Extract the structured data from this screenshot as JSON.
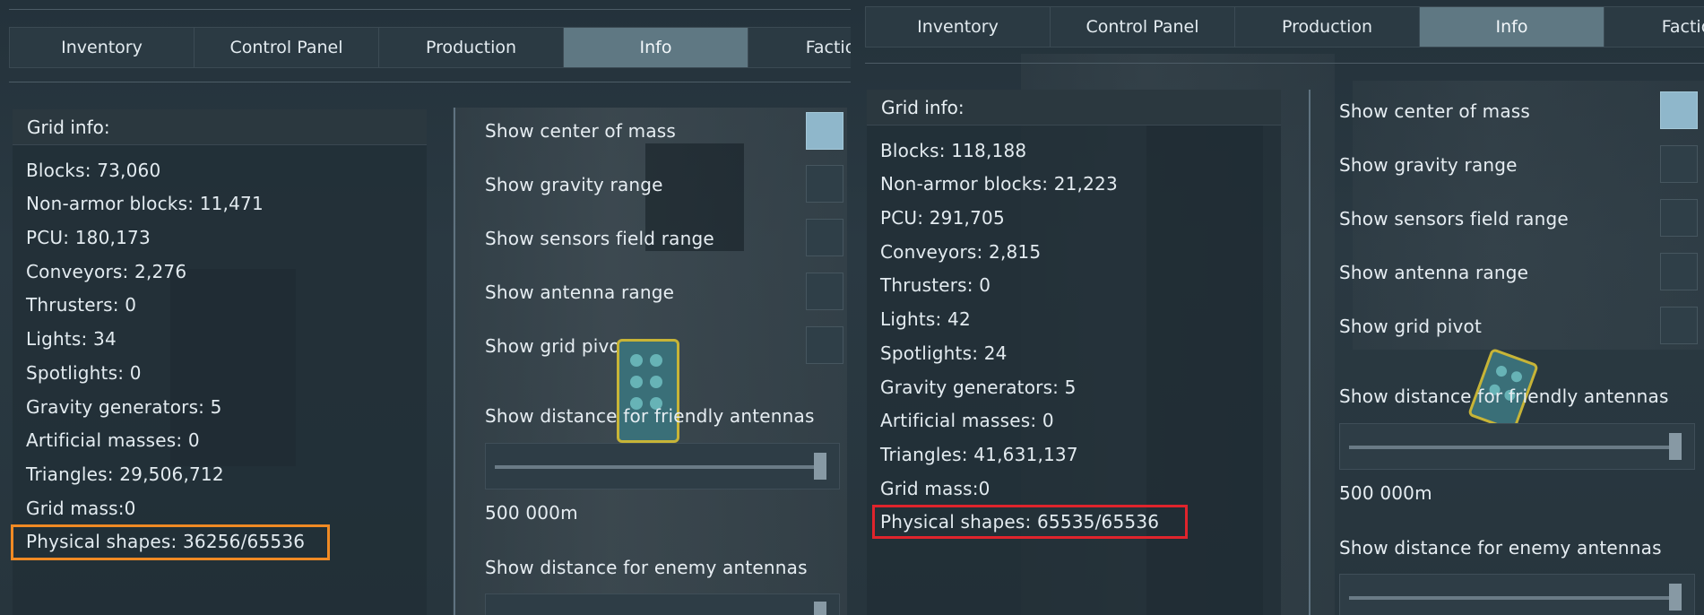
{
  "tabs": [
    "Inventory",
    "Control Panel",
    "Production",
    "Info",
    "Factions"
  ],
  "colors": {
    "tab_active": "#5f7883",
    "checkbox_on": "#8fb7cb",
    "highlight_left": "#f08a24",
    "highlight_right": "#e0242c"
  },
  "icons": {
    "gadget": "terminal-panel-icon"
  },
  "left": {
    "active_tab": "Info",
    "grid_info_title": "Grid info:",
    "stats": [
      "Blocks: 73,060",
      "Non-armor blocks: 11,471",
      "PCU: 180,173",
      "Conveyors: 2,276",
      "Thrusters: 0",
      "Lights: 34",
      "Spotlights: 0",
      "Gravity generators: 5",
      "Artificial masses: 0",
      "Triangles: 29,506,712",
      "Grid mass:0",
      "Physical shapes: 36256/65536"
    ],
    "options": [
      {
        "label": "Show center of mass",
        "checked": true
      },
      {
        "label": "Show gravity range",
        "checked": false
      },
      {
        "label": "Show sensors field range",
        "checked": false
      },
      {
        "label": "Show antenna range",
        "checked": false
      },
      {
        "label": "Show grid pivot",
        "checked": false
      }
    ],
    "friendly_label": "Show distance for friendly antennas",
    "friendly_slider": 1.0,
    "friendly_value": "500 000m",
    "enemy_label": "Show distance for enemy antennas"
  },
  "right": {
    "active_tab": "Info",
    "grid_info_title": "Grid info:",
    "stats": [
      "Blocks: 118,188",
      "Non-armor blocks: 21,223",
      "PCU: 291,705",
      "Conveyors: 2,815",
      "Thrusters: 0",
      "Lights: 42",
      "Spotlights: 24",
      "Gravity generators: 5",
      "Artificial masses: 0",
      "Triangles: 41,631,137",
      "Grid mass:0",
      "Physical shapes: 65535/65536"
    ],
    "options": [
      {
        "label": "Show center of mass",
        "checked": true
      },
      {
        "label": "Show gravity range",
        "checked": false
      },
      {
        "label": "Show sensors field range",
        "checked": false
      },
      {
        "label": "Show antenna range",
        "checked": false
      },
      {
        "label": "Show grid pivot",
        "checked": false
      }
    ],
    "friendly_label": "Show distance for friendly antennas",
    "friendly_slider": 1.0,
    "friendly_value": "500 000m",
    "enemy_label": "Show distance for enemy antennas"
  }
}
